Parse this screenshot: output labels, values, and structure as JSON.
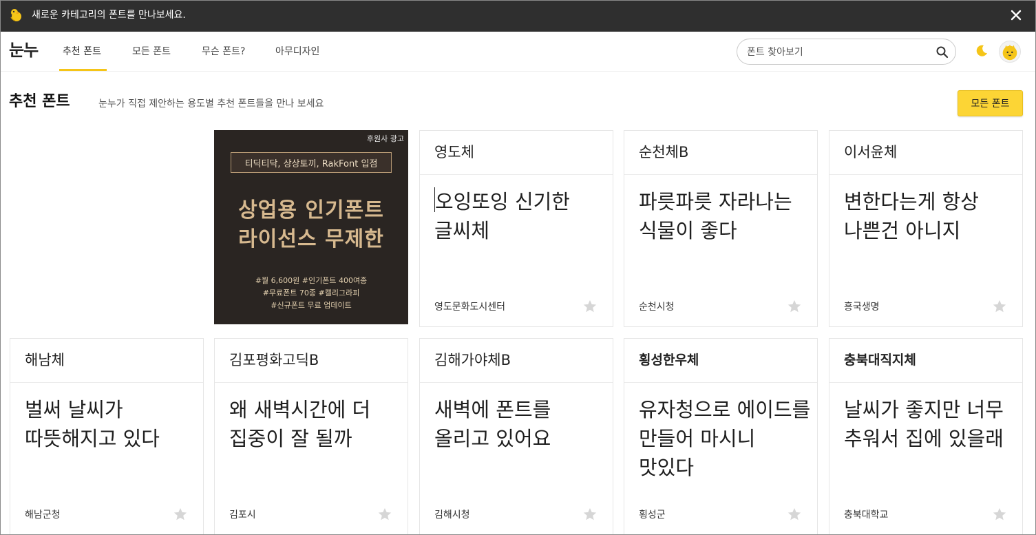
{
  "notice": {
    "text": "새로운 카테고리의 폰트를 만나보세요."
  },
  "nav": {
    "logo": "눈누",
    "links": [
      "추천 폰트",
      "모든 폰트",
      "무슨 폰트?",
      "아무디자인"
    ],
    "search_placeholder": "폰트 찾아보기"
  },
  "section": {
    "title": "추천 폰트",
    "subtitle": "눈누가 직접 제안하는 용도별 추천 폰트들을 만나 보세요",
    "all_button": "모든 폰트"
  },
  "ad": {
    "label": "후원사 광고",
    "banner": "티딕티닥, 상상토끼, RakFont 입점",
    "headline1": "상업용 인기폰트",
    "headline2": "라이선스 무제한",
    "tags1": "#월 6,600원 #인기폰트 400여종",
    "tags2": "#무료폰트 70종 #캘리그라피",
    "tags3": "#신규폰트 무료 업데이트"
  },
  "cards": [
    {
      "name": "영도체",
      "preview": "오잉또잉 신기한 글씨체",
      "maker": "영도문화도시센터"
    },
    {
      "name": "순천체B",
      "preview": "파릇파릇 자라나는 식물이 좋다",
      "maker": "순천시청"
    },
    {
      "name": "이서윤체",
      "preview": "변한다는게 항상 나쁜건 아니지",
      "maker": "흥국생명"
    },
    {
      "name": "해남체",
      "preview": "벌써 날씨가 따뜻해지고 있다",
      "maker": "해남군청"
    },
    {
      "name": "김포평화고딕B",
      "preview": "왜 새벽시간에 더 집중이 잘 될까",
      "maker": "김포시"
    },
    {
      "name": "김해가야체B",
      "preview": "새벽에 폰트를 올리고 있어요",
      "maker": "김해시청"
    },
    {
      "name": "횡성한우체",
      "preview": "유자청으로 에이드를 만들어 마시니 맛있다",
      "maker": "횡성군"
    },
    {
      "name": "충북대직지체",
      "preview": "날씨가 좋지만 너무 추워서 집에 있을래",
      "maker": "충북대학교"
    }
  ],
  "colors": {
    "accent": "#fcd535",
    "notice_bg": "#2f2f2f",
    "star": "#d6d6d6"
  }
}
